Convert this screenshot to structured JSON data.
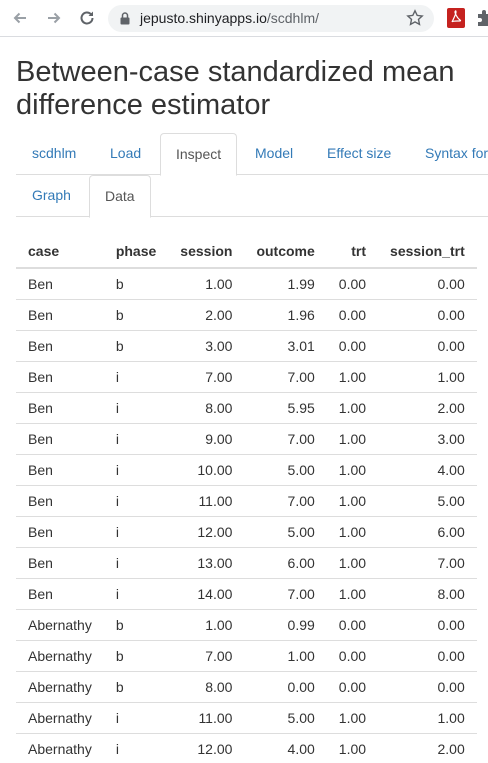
{
  "browser": {
    "url_host": "jepusto.shinyapps.io",
    "url_path": "/scdhlm/"
  },
  "page": {
    "title": "Between-case standardized mean difference estimator"
  },
  "tabs": [
    {
      "label": "scdhlm",
      "active": false
    },
    {
      "label": "Load",
      "active": false
    },
    {
      "label": "Inspect",
      "active": true
    },
    {
      "label": "Model",
      "active": false
    },
    {
      "label": "Effect size",
      "active": false
    },
    {
      "label": "Syntax for",
      "active": false
    }
  ],
  "subtabs": [
    {
      "label": "Graph",
      "active": false
    },
    {
      "label": "Data",
      "active": true
    }
  ],
  "table": {
    "columns": [
      "case",
      "phase",
      "session",
      "outcome",
      "trt",
      "session_trt"
    ],
    "rows": [
      [
        "Ben",
        "b",
        "1.00",
        "1.99",
        "0.00",
        "0.00"
      ],
      [
        "Ben",
        "b",
        "2.00",
        "1.96",
        "0.00",
        "0.00"
      ],
      [
        "Ben",
        "b",
        "3.00",
        "3.01",
        "0.00",
        "0.00"
      ],
      [
        "Ben",
        "i",
        "7.00",
        "7.00",
        "1.00",
        "1.00"
      ],
      [
        "Ben",
        "i",
        "8.00",
        "5.95",
        "1.00",
        "2.00"
      ],
      [
        "Ben",
        "i",
        "9.00",
        "7.00",
        "1.00",
        "3.00"
      ],
      [
        "Ben",
        "i",
        "10.00",
        "5.00",
        "1.00",
        "4.00"
      ],
      [
        "Ben",
        "i",
        "11.00",
        "7.00",
        "1.00",
        "5.00"
      ],
      [
        "Ben",
        "i",
        "12.00",
        "5.00",
        "1.00",
        "6.00"
      ],
      [
        "Ben",
        "i",
        "13.00",
        "6.00",
        "1.00",
        "7.00"
      ],
      [
        "Ben",
        "i",
        "14.00",
        "7.00",
        "1.00",
        "8.00"
      ],
      [
        "Abernathy",
        "b",
        "1.00",
        "0.99",
        "0.00",
        "0.00"
      ],
      [
        "Abernathy",
        "b",
        "7.00",
        "1.00",
        "0.00",
        "0.00"
      ],
      [
        "Abernathy",
        "b",
        "8.00",
        "0.00",
        "0.00",
        "0.00"
      ],
      [
        "Abernathy",
        "i",
        "11.00",
        "5.00",
        "1.00",
        "1.00"
      ],
      [
        "Abernathy",
        "i",
        "12.00",
        "4.00",
        "1.00",
        "2.00"
      ]
    ]
  }
}
